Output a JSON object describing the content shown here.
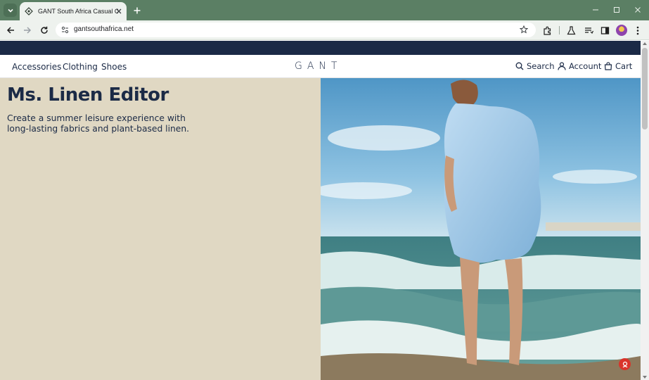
{
  "browser": {
    "tab_title": "GANT South Africa Casual Collection",
    "url": "gantsouthafrica.net",
    "chrome_color": "#5b7f64"
  },
  "site": {
    "nav": [
      "Accessories",
      "Clothing",
      "Shoes"
    ],
    "logo_text": "GANT",
    "actions": {
      "search": "Search",
      "account": "Account",
      "cart": "Cart"
    },
    "brand_color": "#1b2a46"
  },
  "hero": {
    "title": "Ms. Linen Editor",
    "subtitle": "Create a summer leisure experience with long-lasting fabrics and plant-based linen.",
    "bg_color": "#e0d8c3",
    "image_icon": "beach-woman-photo"
  }
}
